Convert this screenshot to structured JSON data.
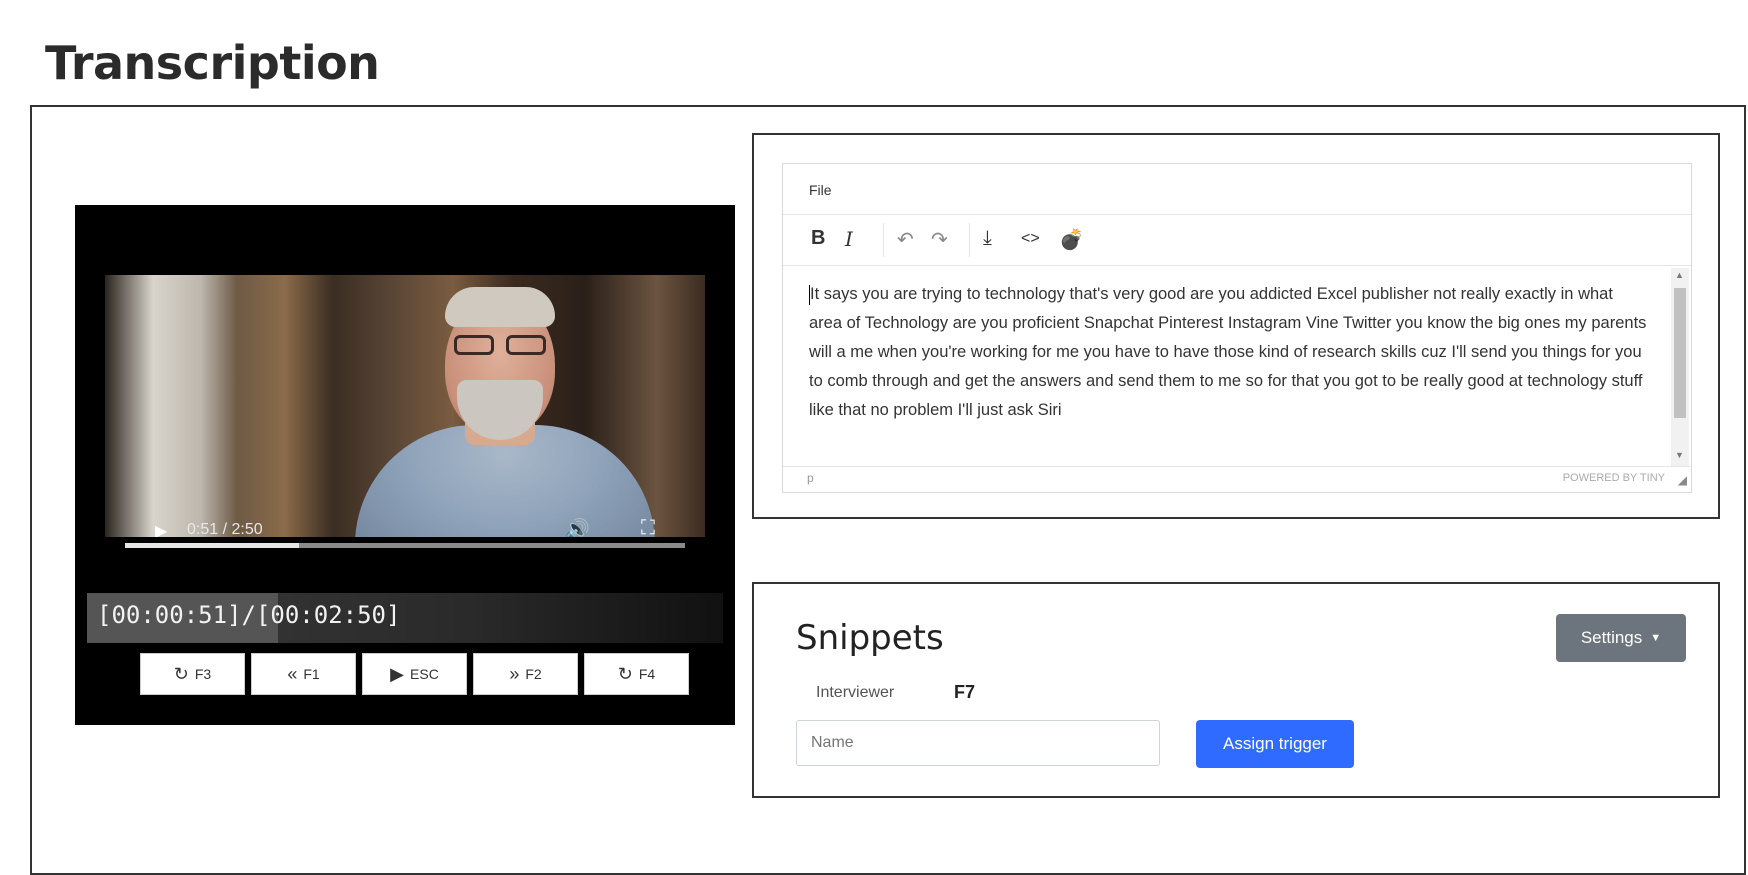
{
  "page": {
    "title": "Transcription"
  },
  "player": {
    "play_icon": "▶",
    "time_display": "0:51 / 2:50",
    "volume_icon": "🔊",
    "fullscreen_icon": "⛶",
    "more_icon": "⋮",
    "progress": 0.31,
    "timecode": "[00:00:51]/[00:02:50]",
    "timecode_progress": 0.3,
    "transport": [
      {
        "icon": "↻",
        "key": "F3"
      },
      {
        "icon": "«",
        "key": "F1"
      },
      {
        "icon": "▶",
        "key": "ESC"
      },
      {
        "icon": "»",
        "key": "F2"
      },
      {
        "icon": "↻",
        "key": "F4"
      }
    ]
  },
  "editor": {
    "menu_file": "File",
    "toolbar": {
      "bold": "B",
      "italic": "I",
      "undo_icon": "↶",
      "redo_icon": "↷",
      "download_icon": "⤓",
      "code_icon": "<>",
      "bomb_icon": "💣"
    },
    "content": "It says you are trying to technology that's very good are you addicted Excel publisher not really exactly in what area of Technology are you proficient Snapchat Pinterest Instagram Vine Twitter you know the big ones my parents will a me when you're working for me you have to have those kind of research skills cuz I'll send you things for you to comb through and get the answers and send them to me so for that you got to be really good at technology stuff like that no problem I'll just ask Siri",
    "status_path": "p",
    "powered_by": "POWERED BY TINY"
  },
  "snippets": {
    "title": "Snippets",
    "settings_label": "Settings",
    "items": [
      {
        "label": "Interviewer",
        "key": "F7"
      }
    ],
    "name_placeholder": "Name",
    "assign_label": "Assign trigger"
  }
}
